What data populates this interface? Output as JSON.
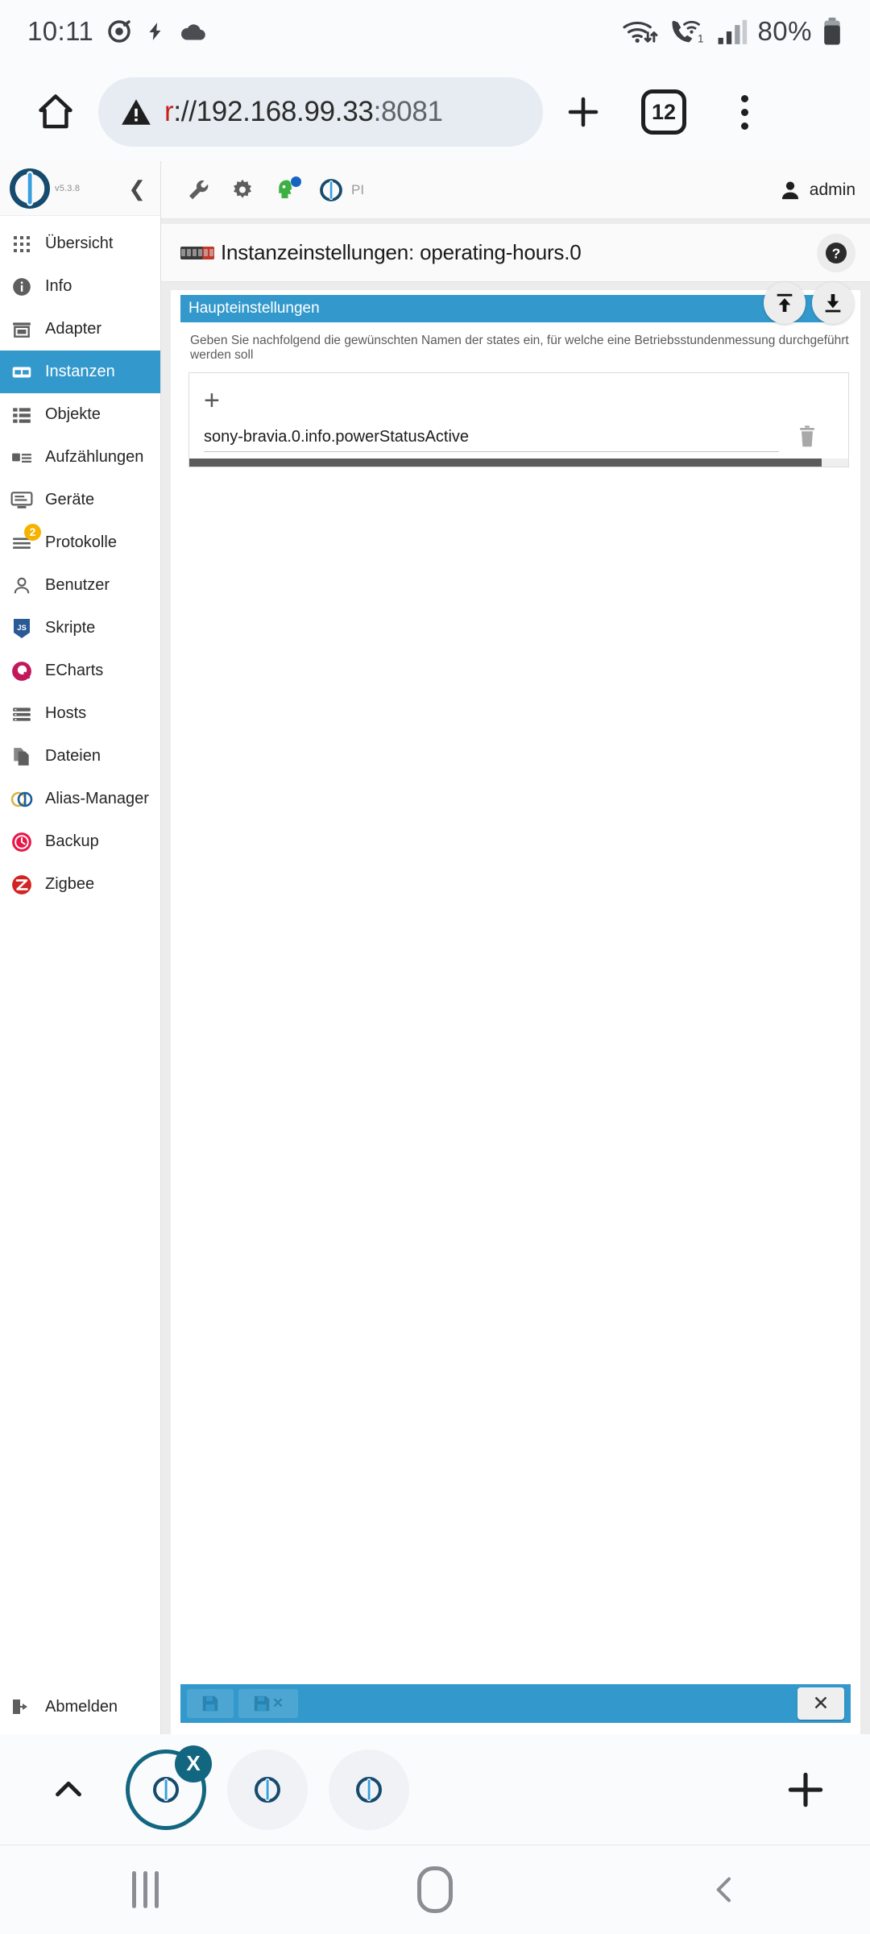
{
  "status_bar": {
    "time": "10:11",
    "left_icons": [
      "location-icon",
      "flash-icon",
      "cloud-icon"
    ],
    "right_icons": [
      "wifi-transfer-icon",
      "wifi-calling-icon",
      "signal-bars-icon"
    ],
    "battery_percent": "80%",
    "wifi_calling_sim": "1"
  },
  "browser": {
    "home_icon": "home-icon",
    "security_icon": "not-secure-warning-icon",
    "url_scheme": "r",
    "url_separator": "://",
    "url_host": "192.168.99.33",
    "url_port": ":8081",
    "url_full": "r://192.168.99.33:8081",
    "new_tab_icon": "plus-icon",
    "tab_count": "12",
    "menu_icon": "kebab-menu-icon",
    "tabs": [
      {
        "label": "ioBroker tab 1",
        "selected": true,
        "close_label": "X"
      },
      {
        "label": "ioBroker tab 2",
        "selected": false
      },
      {
        "label": "ioBroker tab 3",
        "selected": false
      }
    ],
    "tabstrip_collapse_icon": "chevron-up-icon",
    "tabstrip_add_icon": "plus-icon"
  },
  "app": {
    "logo": "iobroker-logo",
    "version": "v5.3.8",
    "collapse_icon": "chevron-left-icon",
    "toolbar": [
      {
        "name": "wrench-icon",
        "label": ""
      },
      {
        "name": "gear-icon",
        "label": ""
      },
      {
        "name": "expert-mode-head-icon",
        "label": ""
      }
    ],
    "host_icon": "iobroker-logo",
    "host_name": "PI",
    "user_icon": "person-icon",
    "user_name": "admin"
  },
  "sidebar": {
    "items": [
      {
        "label": "Übersicht",
        "icon": "grid-icon",
        "active": false
      },
      {
        "label": "Info",
        "icon": "info-icon",
        "active": false
      },
      {
        "label": "Adapter",
        "icon": "store-icon",
        "active": false
      },
      {
        "label": "Instanzen",
        "icon": "instances-icon",
        "active": true
      },
      {
        "label": "Objekte",
        "icon": "list-icon",
        "active": false
      },
      {
        "label": "Aufzählungen",
        "icon": "enums-icon",
        "active": false
      },
      {
        "label": "Geräte",
        "icon": "devices-icon",
        "active": false
      },
      {
        "label": "Protokolle",
        "icon": "logs-icon",
        "active": false,
        "badge": "2"
      },
      {
        "label": "Benutzer",
        "icon": "user-icon",
        "active": false
      },
      {
        "label": "Skripte",
        "icon": "javascript-icon",
        "active": false
      },
      {
        "label": "ECharts",
        "icon": "echarts-icon",
        "active": false
      },
      {
        "label": "Hosts",
        "icon": "hosts-icon",
        "active": false
      },
      {
        "label": "Dateien",
        "icon": "files-icon",
        "active": false
      },
      {
        "label": "Alias-Manager",
        "icon": "alias-manager-icon",
        "active": false
      },
      {
        "label": "Backup",
        "icon": "backup-icon",
        "active": false
      },
      {
        "label": "Zigbee",
        "icon": "zigbee-icon",
        "active": false
      }
    ],
    "logout": {
      "label": "Abmelden",
      "icon": "logout-icon"
    }
  },
  "main": {
    "title_icon": "operating-hours-counter-icon",
    "title": "Instanzeinstellungen: operating-hours.0",
    "help_icon": "help-question-icon",
    "tabs": [
      {
        "label": "Haupteinstellungen",
        "active": true
      }
    ],
    "upload_icon": "upload-icon",
    "download_icon": "download-icon",
    "hint": "Geben Sie nachfolgend die gewünschten Namen der states ein, für welche eine Betriebsstundenmessung durchgeführt werden soll",
    "add_button": {
      "label": "+",
      "name": "add-state-button"
    },
    "rows": [
      {
        "value": "sony-bravia.0.info.powerStatusActive",
        "delete_icon": "trash-icon"
      }
    ],
    "footer": {
      "save_icon": "save-icon",
      "save_close_icon": "save-and-close-icon",
      "close_label": "✕"
    }
  },
  "android_nav": {
    "recents": "recents-icon",
    "home": "home-icon",
    "back": "back-icon"
  },
  "colors": {
    "accent": "#3399cc",
    "badge": "#f5b300",
    "tab_selected_ring": "#12667f",
    "url_warning": "#c5221f"
  }
}
